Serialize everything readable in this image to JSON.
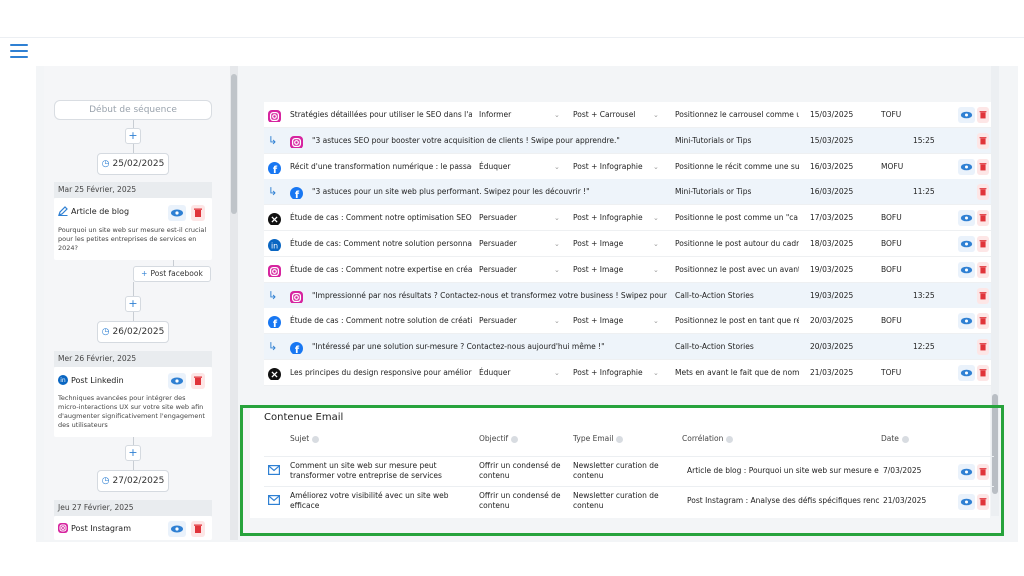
{
  "timeline": {
    "start_label": "Début de séquence",
    "dates": [
      "25/02/2025",
      "26/02/2025",
      "27/02/2025"
    ],
    "days": [
      {
        "header": "Mar 25 Février, 2025",
        "card_title": "Article de blog",
        "card_desc": "Pourquoi un site web sur mesure est-il crucial pour les petites entreprises de services en 2024?"
      },
      {
        "header": "Mer 26 Février, 2025",
        "card_title": "Post Linkedin",
        "card_desc": "Techniques avancées pour intégrer des micro-interactions UX sur votre site web afin d'augmenter significativement l'engagement des utilisateurs"
      },
      {
        "header": "Jeu 27 Février, 2025",
        "card_title": "Post Instagram",
        "card_desc": ""
      }
    ],
    "post_facebook_label": "Post facebook"
  },
  "social_rows": [
    {
      "kind": "main",
      "network": "instagram",
      "title": "Stratégies détaillées pour utiliser le SEO dans l'ac",
      "objectif": "Informer",
      "format": "Post + Carrousel",
      "positioning": "Positionnez le carrousel comme u",
      "date": "15/03/2025",
      "funnel": "TOFU",
      "time": ""
    },
    {
      "kind": "sub",
      "network": "instagram",
      "title": "\"3 astuces SEO pour booster votre acquisition de clients ! Swipe pour apprendre.\"",
      "objectif": "",
      "format": "",
      "positioning": "Mini-Tutorials or Tips",
      "date": "15/03/2025",
      "funnel": "",
      "time": "15:25"
    },
    {
      "kind": "main",
      "network": "facebook",
      "title": "Récit d'une transformation numérique : le passaç",
      "objectif": "Éduquer",
      "format": "Post + Infographie",
      "positioning": "Positionne le récit comme une su",
      "date": "16/03/2025",
      "funnel": "MOFU",
      "time": ""
    },
    {
      "kind": "sub",
      "network": "facebook",
      "title": "\"3 astuces pour un site web plus performant. Swipez pour les découvrir !\"",
      "objectif": "",
      "format": "",
      "positioning": "Mini-Tutorials or Tips",
      "date": "16/03/2025",
      "funnel": "",
      "time": "11:25"
    },
    {
      "kind": "main",
      "network": "x",
      "title": "Étude de cas : Comment notre optimisation SEO",
      "objectif": "Persuader",
      "format": "Post + Infographie",
      "positioning": "Positionne le post comme un \"ca",
      "date": "17/03/2025",
      "funnel": "BOFU",
      "time": ""
    },
    {
      "kind": "main",
      "network": "linkedin",
      "title": "Étude de cas: Comment notre solution personna",
      "objectif": "Persuader",
      "format": "Post + Image",
      "positioning": "Positionne le post autour du cadr",
      "date": "18/03/2025",
      "funnel": "BOFU",
      "time": ""
    },
    {
      "kind": "main",
      "network": "instagram",
      "title": "Étude de cas : Comment notre expertise en créa",
      "objectif": "Persuader",
      "format": "Post + Image",
      "positioning": "Positionnez le post avec un avant",
      "date": "19/03/2025",
      "funnel": "BOFU",
      "time": ""
    },
    {
      "kind": "sub",
      "network": "instagram",
      "title": "\"Impressionné par nos résultats ? Contactez-nous et transformez votre business ! Swipez pour e",
      "objectif": "",
      "format": "",
      "positioning": "Call-to-Action Stories",
      "date": "19/03/2025",
      "funnel": "",
      "time": "13:25"
    },
    {
      "kind": "main",
      "network": "facebook",
      "title": "Étude de cas : Comment notre solution de créati",
      "objectif": "Persuader",
      "format": "Post + Image",
      "positioning": "Positionnez le post en tant que ré",
      "date": "20/03/2025",
      "funnel": "BOFU",
      "time": ""
    },
    {
      "kind": "sub",
      "network": "facebook",
      "title": "\"Intéressé par une solution sur-mesure ? Contactez-nous aujourd'hui même !\"",
      "objectif": "",
      "format": "",
      "positioning": "Call-to-Action Stories",
      "date": "20/03/2025",
      "funnel": "",
      "time": "12:25"
    },
    {
      "kind": "main",
      "network": "x",
      "title": "Les principes du design responsive pour amélior",
      "objectif": "Éduquer",
      "format": "Post + Infographie",
      "positioning": "Mets en avant le fait que de nom",
      "date": "21/03/2025",
      "funnel": "TOFU",
      "time": ""
    }
  ],
  "email": {
    "title": "Contenue Email",
    "headers": {
      "sujet": "Sujet",
      "objectif": "Objectif",
      "type": "Type Email",
      "correlation": "Corrélation",
      "date": "Date"
    },
    "rows": [
      {
        "sujet": [
          "Comment un site web sur mesure peut",
          "transformer votre entreprise de services"
        ],
        "objectif": [
          "Offrir un condensé de",
          "contenu"
        ],
        "type": [
          "Newsletter curation de",
          "contenu"
        ],
        "correlation": "Article de blog : Pourquoi un site web sur mesure es",
        "date": "7/03/2025"
      },
      {
        "sujet": [
          "Améliorez votre visibilité avec un site web",
          "efficace"
        ],
        "objectif": [
          "Offrir un condensé de",
          "contenu"
        ],
        "type": [
          "Newsletter curation de",
          "contenu"
        ],
        "correlation": "Post Instagram : Analyse des défis spécifiques renc",
        "date": "21/03/2025"
      }
    ]
  },
  "colors": {
    "accent": "#2f80d3",
    "danger": "#e0343a",
    "highlight_border": "#27a33c",
    "sub_row": "#eef4fa"
  }
}
